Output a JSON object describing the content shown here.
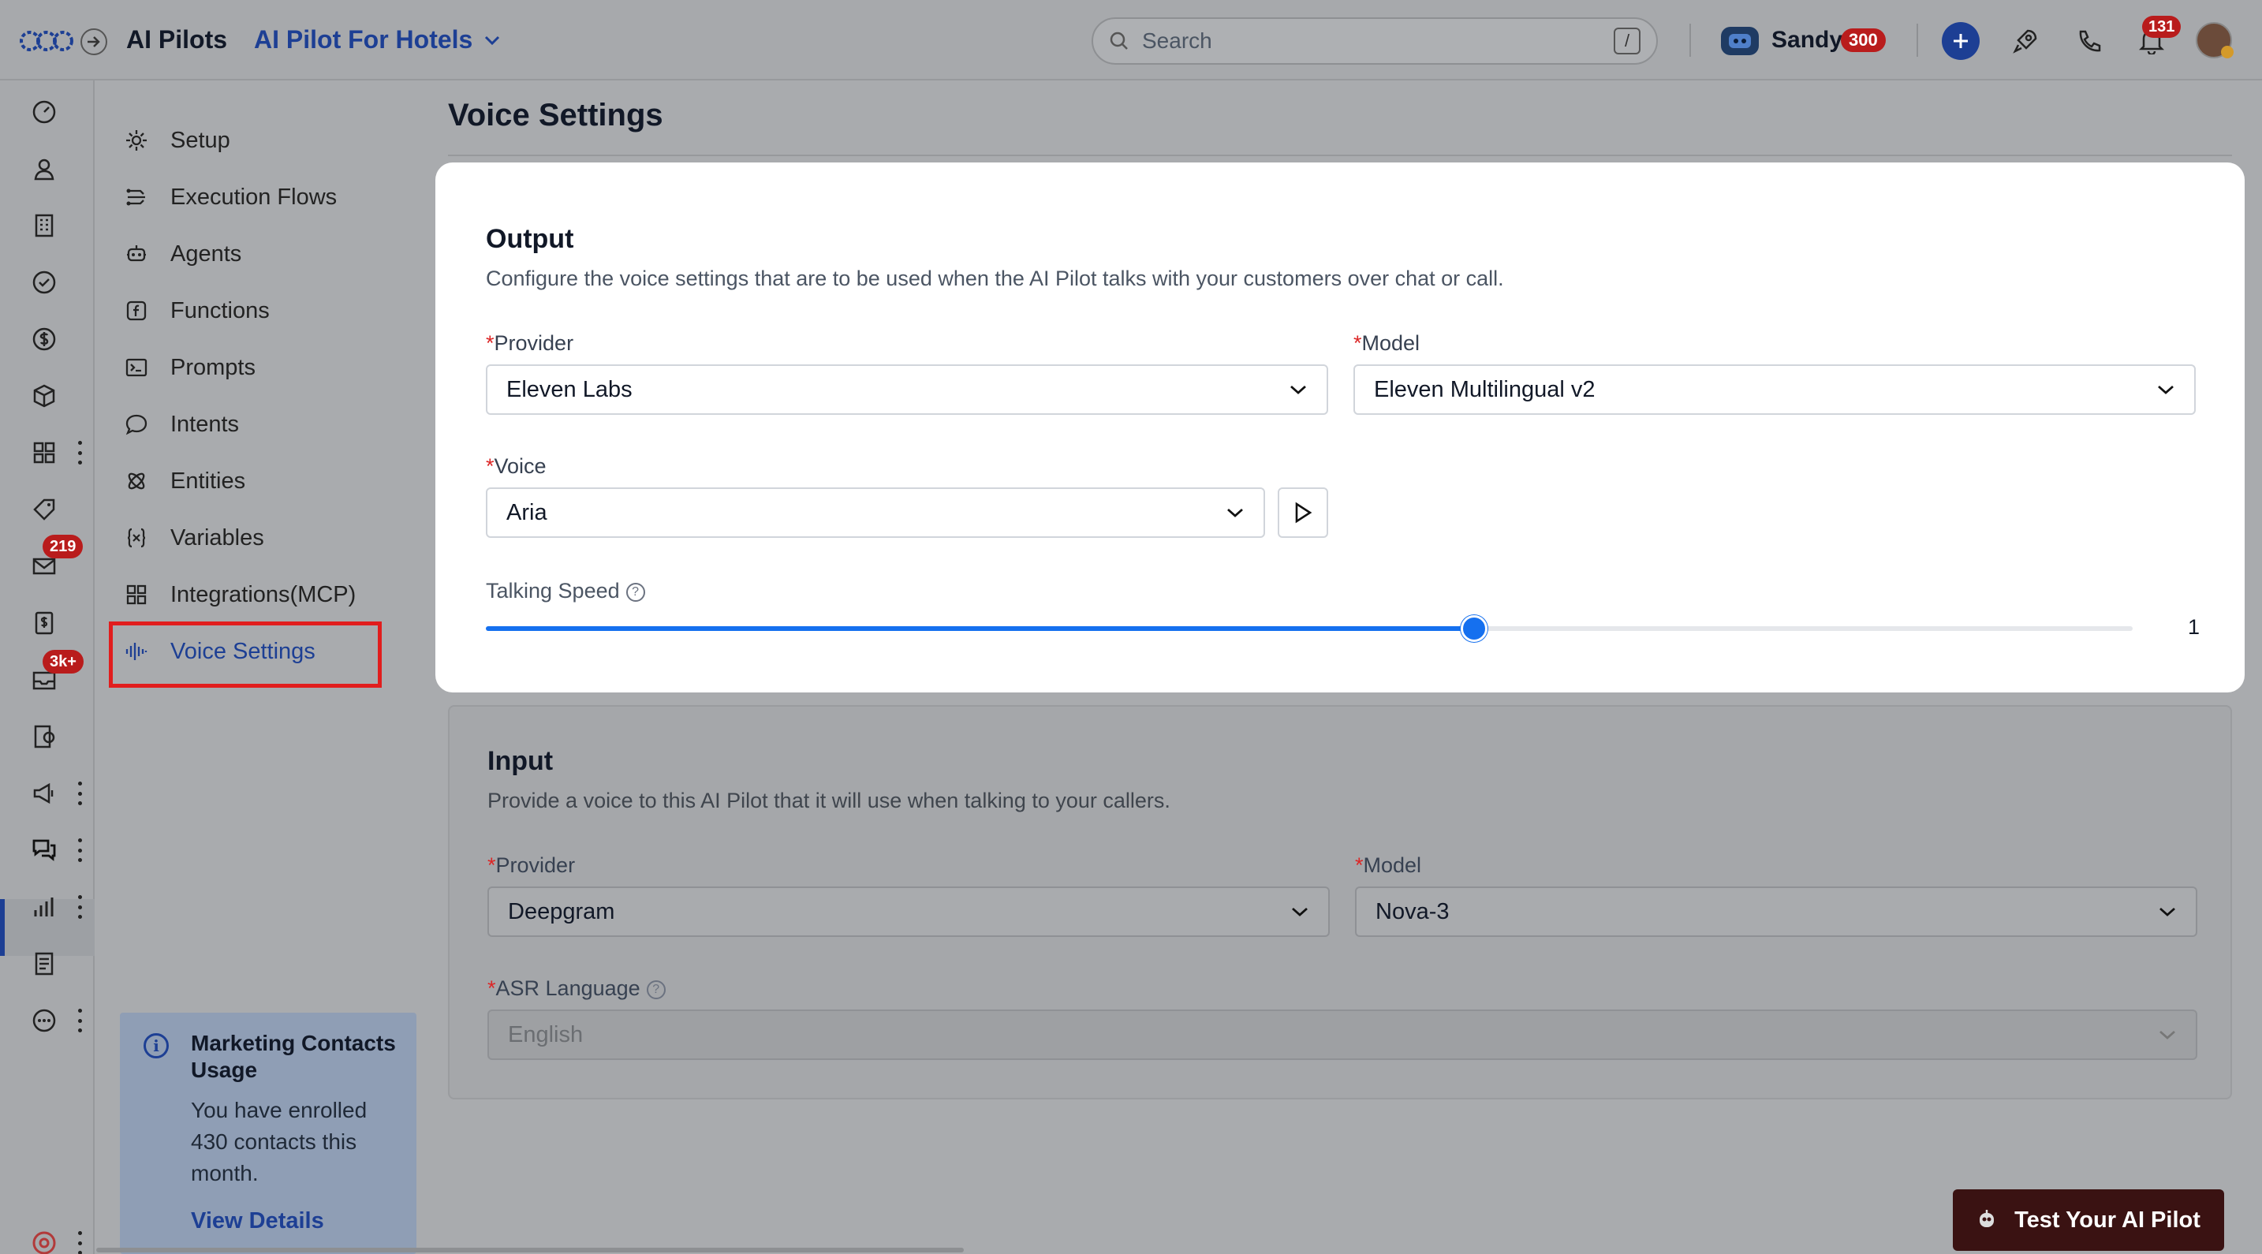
{
  "header": {
    "app_title": "AI Pilots",
    "pilot_name": "AI Pilot For Hotels",
    "search_placeholder": "Search",
    "search_shortcut": "/",
    "user_name": "Sandy",
    "user_points": "300",
    "notifications_count": "131"
  },
  "rail": {
    "badges": {
      "mail": "219",
      "inbox": "3k+"
    }
  },
  "subnav": {
    "items": [
      {
        "label": "Setup",
        "icon": "gear-icon"
      },
      {
        "label": "Execution Flows",
        "icon": "flow-icon"
      },
      {
        "label": "Agents",
        "icon": "robot-icon"
      },
      {
        "label": "Functions",
        "icon": "function-icon"
      },
      {
        "label": "Prompts",
        "icon": "terminal-icon"
      },
      {
        "label": "Intents",
        "icon": "chat-icon"
      },
      {
        "label": "Entities",
        "icon": "atom-icon"
      },
      {
        "label": "Variables",
        "icon": "variable-icon"
      },
      {
        "label": "Integrations(MCP)",
        "icon": "grid-icon"
      },
      {
        "label": "Voice Settings",
        "icon": "waveform-icon"
      }
    ],
    "active": "Voice Settings"
  },
  "usage": {
    "title": "Marketing Contacts Usage",
    "text": "You have enrolled 430 contacts this month.",
    "link": "View Details"
  },
  "page": {
    "title": "Voice Settings"
  },
  "output": {
    "title": "Output",
    "description": "Configure the voice settings that are to be used when the AI Pilot talks with your customers over chat or call.",
    "provider_label": "Provider",
    "provider_value": "Eleven Labs",
    "model_label": "Model",
    "model_value": "Eleven Multilingual v2",
    "voice_label": "Voice",
    "voice_value": "Aria",
    "speed_label": "Talking Speed",
    "speed_value": "1",
    "speed_fraction": 0.6
  },
  "input": {
    "title": "Input",
    "description": "Provide a voice to this AI Pilot that it will use when talking to your callers.",
    "provider_label": "Provider",
    "provider_value": "Deepgram",
    "model_label": "Model",
    "model_value": "Nova-3",
    "asr_label": "ASR Language",
    "asr_value": "English"
  },
  "footer": {
    "test_button": "Test Your AI Pilot"
  },
  "colors": {
    "accent": "#1570ef",
    "brand": "#1d3f94",
    "badge": "#b91c1c",
    "highlight": "#e11d1d"
  }
}
